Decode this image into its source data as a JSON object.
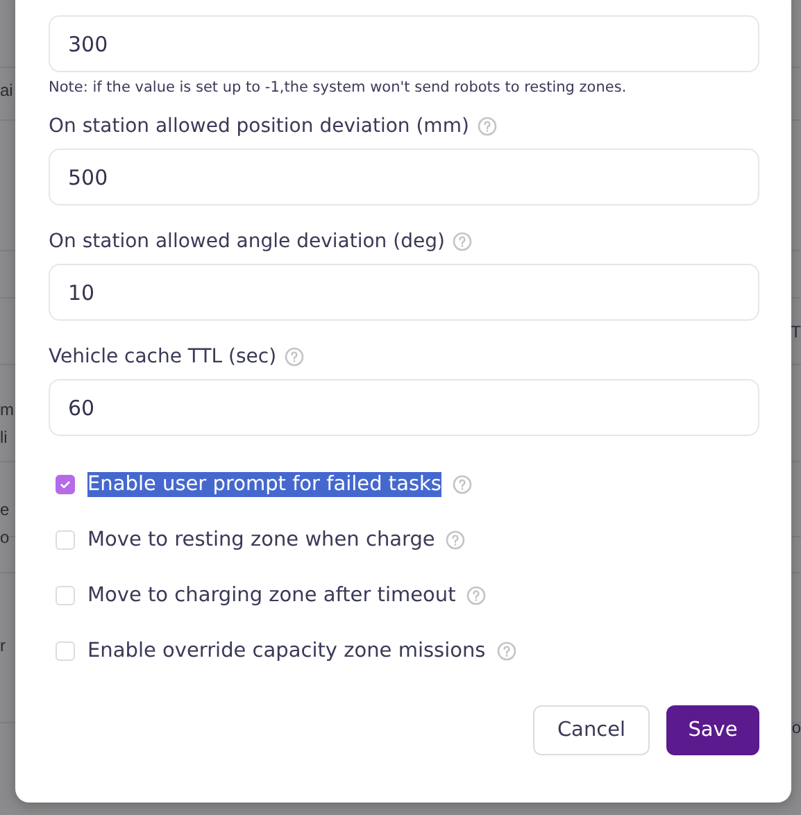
{
  "background": {
    "left_fragments": [
      "ai",
      "m",
      "li",
      "e",
      "o",
      "r"
    ],
    "right_fragments": [
      "T",
      "o"
    ]
  },
  "dialog": {
    "fields": [
      {
        "value": "300",
        "note": "Note: if the value is set up to -1,the system won't send robots to resting zones."
      },
      {
        "label": "On station allowed position deviation (mm)",
        "value": "500"
      },
      {
        "label": "On station allowed angle deviation (deg)",
        "value": "10"
      },
      {
        "label": "Vehicle cache TTL (sec)",
        "value": "60"
      }
    ],
    "checkboxes": [
      {
        "label": "Enable user prompt for failed tasks",
        "checked": true,
        "text_selected": true
      },
      {
        "label": "Move to resting zone when charge",
        "checked": false,
        "text_selected": false
      },
      {
        "label": "Move to charging zone after timeout",
        "checked": false,
        "text_selected": false
      },
      {
        "label": "Enable override capacity zone missions",
        "checked": false,
        "text_selected": false
      }
    ],
    "buttons": [
      {
        "label": "Cancel",
        "kind": "secondary"
      },
      {
        "label": "Save",
        "kind": "primary"
      }
    ]
  }
}
